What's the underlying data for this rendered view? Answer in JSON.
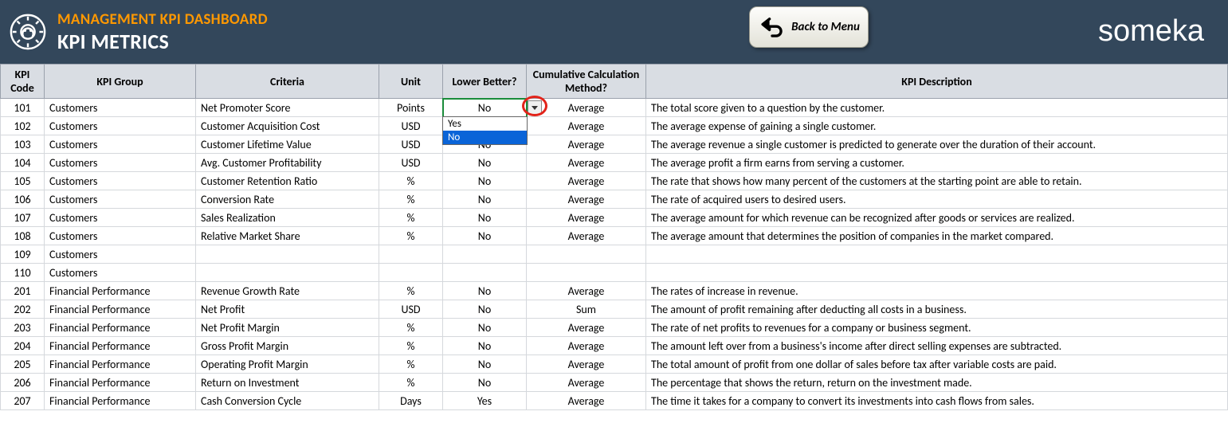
{
  "header": {
    "dashboard_title": "MANAGEMENT KPI DASHBOARD",
    "page_title": "KPI METRICS",
    "back_label": "Back to Menu",
    "brand": "someka"
  },
  "columns": {
    "code": "KPI Code",
    "group": "KPI Group",
    "criteria": "Criteria",
    "unit": "Unit",
    "lower": "Lower Better?",
    "calc": "Cumulative Calculation Method?",
    "desc": "KPI Description"
  },
  "dropdown": {
    "options": [
      "Yes",
      "No"
    ],
    "selected": "No"
  },
  "rows": [
    {
      "code": "101",
      "group": "Customers",
      "criteria": "Net Promoter Score",
      "unit": "Points",
      "lower": "No",
      "calc": "Average",
      "desc": "The total score given to a question by the customer."
    },
    {
      "code": "102",
      "group": "Customers",
      "criteria": "Customer Acquisition Cost",
      "unit": "USD",
      "lower": "Yes",
      "calc": "Average",
      "desc": "The average expense of gaining a single customer."
    },
    {
      "code": "103",
      "group": "Customers",
      "criteria": "Customer Lifetime Value",
      "unit": "USD",
      "lower": "No",
      "calc": "Average",
      "desc": "The average revenue a single customer is predicted to generate over the duration of their account."
    },
    {
      "code": "104",
      "group": "Customers",
      "criteria": "Avg. Customer Profitability",
      "unit": "USD",
      "lower": "No",
      "calc": "Average",
      "desc": "The average profit a firm earns from serving a customer."
    },
    {
      "code": "105",
      "group": "Customers",
      "criteria": "Customer Retention Ratio",
      "unit": "%",
      "lower": "No",
      "calc": "Average",
      "desc": "The rate that shows how many percent of the customers at the starting point are able to retain."
    },
    {
      "code": "106",
      "group": "Customers",
      "criteria": "Conversion Rate",
      "unit": "%",
      "lower": "No",
      "calc": "Average",
      "desc": "The rate of acquired users to desired users."
    },
    {
      "code": "107",
      "group": "Customers",
      "criteria": "Sales Realization",
      "unit": "%",
      "lower": "No",
      "calc": "Average",
      "desc": "The average amount for which revenue can be recognized after goods or services are realized."
    },
    {
      "code": "108",
      "group": "Customers",
      "criteria": "Relative Market Share",
      "unit": "%",
      "lower": "No",
      "calc": "Average",
      "desc": "The average amount that determines the position of companies in the market compared."
    },
    {
      "code": "109",
      "group": "Customers",
      "criteria": "",
      "unit": "",
      "lower": "",
      "calc": "",
      "desc": ""
    },
    {
      "code": "110",
      "group": "Customers",
      "criteria": "",
      "unit": "",
      "lower": "",
      "calc": "",
      "desc": ""
    },
    {
      "code": "201",
      "group": "Financial Performance",
      "criteria": "Revenue Growth Rate",
      "unit": "%",
      "lower": "No",
      "calc": "Average",
      "desc": "The rates of increase in revenue."
    },
    {
      "code": "202",
      "group": "Financial Performance",
      "criteria": "Net Profit",
      "unit": "USD",
      "lower": "No",
      "calc": "Sum",
      "desc": "The amount of profit remaining after deducting all costs in a business."
    },
    {
      "code": "203",
      "group": "Financial Performance",
      "criteria": "Net Profit Margin",
      "unit": "%",
      "lower": "No",
      "calc": "Average",
      "desc": "The rate of net profits to revenues for a company or business segment."
    },
    {
      "code": "204",
      "group": "Financial Performance",
      "criteria": "Gross Profit Margin",
      "unit": "%",
      "lower": "No",
      "calc": "Average",
      "desc": "The amount left over from a business's income after direct selling expenses are subtracted."
    },
    {
      "code": "205",
      "group": "Financial Performance",
      "criteria": "Operating Profit Margin",
      "unit": "%",
      "lower": "No",
      "calc": "Average",
      "desc": "The total amount of profit from one dollar of sales before tax after variable costs are paid."
    },
    {
      "code": "206",
      "group": "Financial Performance",
      "criteria": "Return on Investment",
      "unit": "%",
      "lower": "No",
      "calc": "Average",
      "desc": "The percentage that shows the return, return on the investment made."
    },
    {
      "code": "207",
      "group": "Financial Performance",
      "criteria": "Cash Conversion Cycle",
      "unit": "Days",
      "lower": "Yes",
      "calc": "Average",
      "desc": "The time it takes for a company to convert its investments into cash flows from sales."
    }
  ]
}
